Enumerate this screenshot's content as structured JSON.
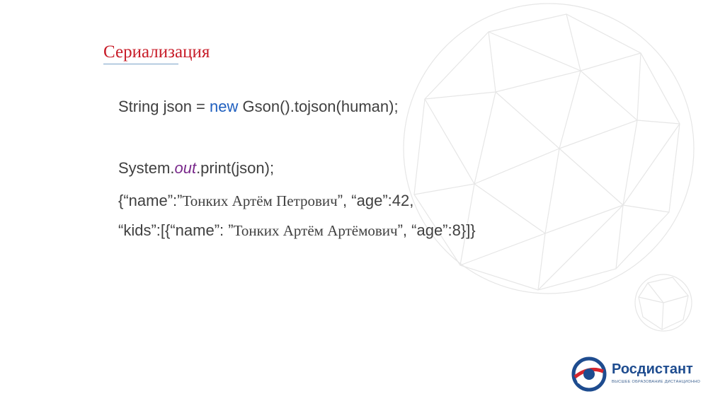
{
  "slide": {
    "title": "Сериализация",
    "line1": {
      "a": "String json = ",
      "kw": "new",
      "b": " Gson().tojson(human);"
    },
    "line2": {
      "a": "System.",
      "it": "out",
      "b": ".print(json);"
    },
    "line3": {
      "a": "{“name”:”",
      "ru": "Тонких Артём Петрович",
      "b": "”, “age”:42,"
    },
    "line4": {
      "a": "“kids”:[{“name”: ”",
      "ru": "Тонких Артём Артёмович",
      "b": "”, “age”:8}]}"
    }
  },
  "logo": {
    "name": "Росдистант",
    "tagline": "ВЫСШЕЕ ОБРАЗОВАНИЕ ДИСТАНЦИОННО",
    "colors": {
      "blue": "#1e4c8f",
      "red": "#d6262d"
    }
  },
  "colors": {
    "title": "#c81e2a",
    "keyword": "#1f5fbf",
    "italic": "#7a2a8c",
    "text": "#404040"
  }
}
